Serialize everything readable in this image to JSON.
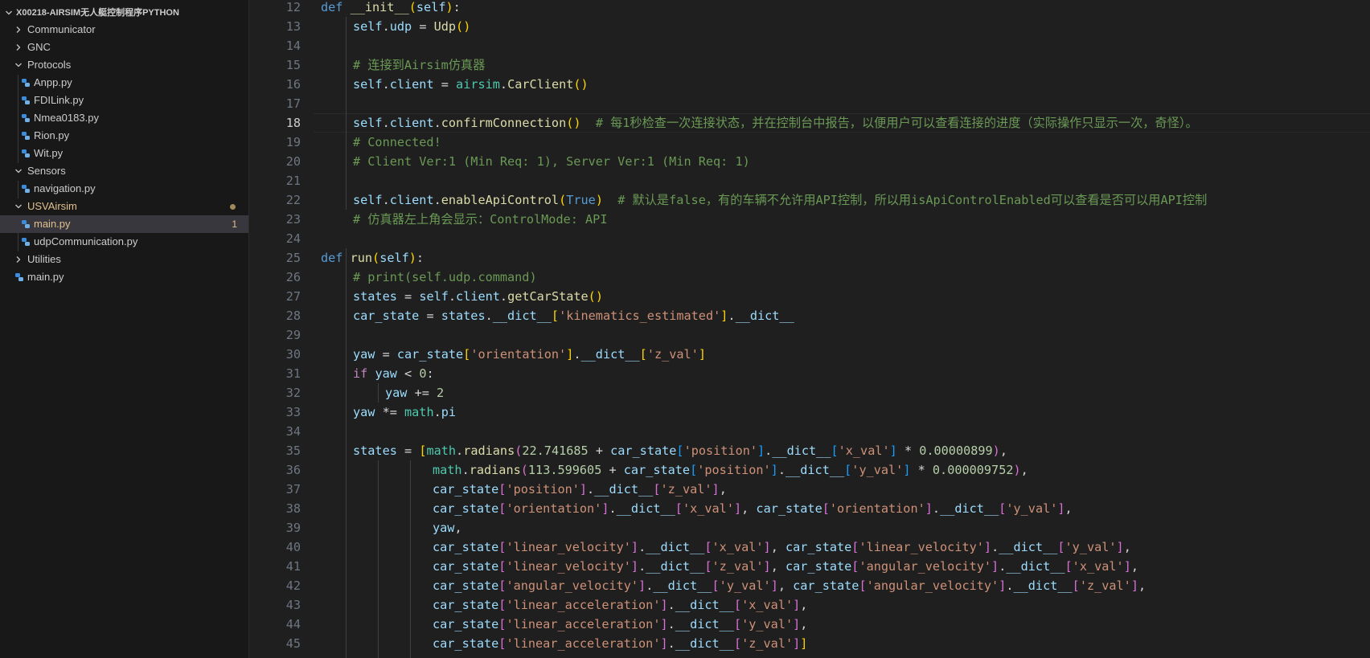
{
  "explorer": {
    "root_label": "X00218-AIRSIM无人艇控制程序PYTHON",
    "items": [
      {
        "label": "Communicator",
        "type": "folder",
        "expanded": false,
        "depth": 1
      },
      {
        "label": "GNC",
        "type": "folder",
        "expanded": false,
        "depth": 1
      },
      {
        "label": "Protocols",
        "type": "folder",
        "expanded": true,
        "depth": 1
      },
      {
        "label": "Anpp.py",
        "type": "file",
        "depth": 2
      },
      {
        "label": "FDILink.py",
        "type": "file",
        "depth": 2
      },
      {
        "label": "Nmea0183.py",
        "type": "file",
        "depth": 2
      },
      {
        "label": "Rion.py",
        "type": "file",
        "depth": 2
      },
      {
        "label": "Wit.py",
        "type": "file",
        "depth": 2
      },
      {
        "label": "Sensors",
        "type": "folder",
        "expanded": true,
        "depth": 1
      },
      {
        "label": "navigation.py",
        "type": "file",
        "depth": 2
      },
      {
        "label": "USVAirsim",
        "type": "folder",
        "expanded": true,
        "depth": 1,
        "modified": true
      },
      {
        "label": "main.py",
        "type": "file",
        "depth": 2,
        "modified": true,
        "selected": true,
        "badge": "1"
      },
      {
        "label": "udpCommunication.py",
        "type": "file",
        "depth": 2
      },
      {
        "label": "Utilities",
        "type": "folder",
        "expanded": false,
        "depth": 1
      },
      {
        "label": "main.py",
        "type": "file",
        "depth": 1
      }
    ]
  },
  "editor": {
    "active_line": 18,
    "line_numbers": [
      "12",
      "13",
      "14",
      "15",
      "16",
      "17",
      "18",
      "19",
      "20",
      "21",
      "22",
      "23",
      "24",
      "25",
      "26",
      "27",
      "28",
      "29",
      "30",
      "31",
      "32",
      "33",
      "34",
      "35",
      "36",
      "37",
      "38",
      "39",
      "40",
      "41",
      "42",
      "43",
      "44",
      "45"
    ],
    "comments": {
      "c15": "# 连接到Airsim仿真器",
      "c18": "# 每1秒检查一次连接状态，并在控制台中报告，以便用户可以查看连接的进度（实际操作只显示一次，奇怪）。",
      "c19": "# Connected!",
      "c20": "# Client Ver:1 (Min Req: 1), Server Ver:1 (Min Req: 1)",
      "c22": "# 默认是false，有的车辆不允许用API控制，所以用isApiControlEnabled可以查看是否可以用API控制",
      "c23": "# 仿真器左上角会显示：ControlMode: API",
      "c26": "# print(self.udp.command)"
    },
    "tokens": {
      "def": "def",
      "init": "__init__",
      "self": "self",
      "udp": "udp",
      "Udp": "Udp",
      "client": "client",
      "airsim": "airsim",
      "CarClient": "CarClient",
      "confirmConnection": "confirmConnection",
      "enableApiControl": "enableApiControl",
      "True": "True",
      "run": "run",
      "states": "states",
      "getCarState": "getCarState",
      "car_state": "car_state",
      "dict": "__dict__",
      "kinematics_estimated": "'kinematics_estimated'",
      "yaw": "yaw",
      "orientation": "'orientation'",
      "z_val": "'z_val'",
      "x_val": "'x_val'",
      "y_val": "'y_val'",
      "if": "if",
      "zero": "0",
      "two": "2",
      "math": "math",
      "pi": "pi",
      "radians": "radians",
      "lat0": "22.741685",
      "lon0": "113.599605",
      "position": "'position'",
      "kx": "0.00000899",
      "ky": "0.000009752",
      "linear_velocity": "'linear_velocity'",
      "angular_velocity": "'angular_velocity'",
      "linear_acceleration": "'linear_acceleration'"
    }
  }
}
